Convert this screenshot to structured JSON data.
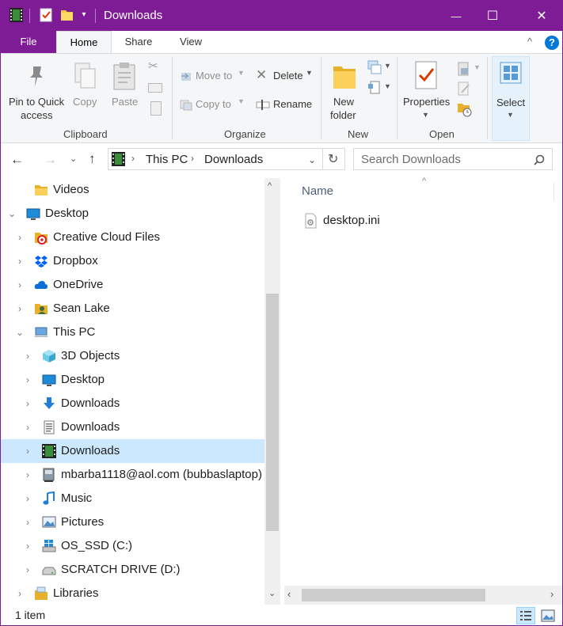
{
  "window": {
    "title": "Downloads"
  },
  "titlebar": {
    "minimize": "—",
    "maximize": "☐",
    "close": "✕"
  },
  "tabs": {
    "file": "File",
    "home": "Home",
    "share": "Share",
    "view": "View"
  },
  "ribbon": {
    "clipboard": {
      "pin": "Pin to Quick access",
      "pin_line1": "Pin to Quick",
      "pin_line2": "access",
      "copy": "Copy",
      "paste": "Paste",
      "group": "Clipboard"
    },
    "organize": {
      "move_to": "Move to",
      "copy_to": "Copy to",
      "delete": "Delete",
      "rename": "Rename",
      "group": "Organize"
    },
    "new": {
      "new_folder_line1": "New",
      "new_folder_line2": "folder",
      "group": "New"
    },
    "open": {
      "properties": "Properties",
      "group": "Open"
    },
    "select": {
      "label": "Select"
    }
  },
  "address": {
    "crumbs": [
      "This PC",
      "Downloads"
    ],
    "search_placeholder": "Search Downloads"
  },
  "nav_items": [
    {
      "label": "Videos",
      "icon": "folder-icon",
      "level": 1,
      "chevron": ""
    },
    {
      "label": "Desktop",
      "icon": "desktop-icon",
      "level": 0,
      "chevron": "expanded"
    },
    {
      "label": "Creative Cloud Files",
      "icon": "creative-cloud-icon",
      "level": 1,
      "chevron": "collapsed"
    },
    {
      "label": "Dropbox",
      "icon": "dropbox-icon",
      "level": 1,
      "chevron": "collapsed"
    },
    {
      "label": "OneDrive",
      "icon": "onedrive-icon",
      "level": 1,
      "chevron": "collapsed"
    },
    {
      "label": "Sean Lake",
      "icon": "user-folder-icon",
      "level": 1,
      "chevron": "collapsed"
    },
    {
      "label": "This PC",
      "icon": "computer-icon",
      "level": 1,
      "chevron": "expanded"
    },
    {
      "label": "3D Objects",
      "icon": "3d-objects-icon",
      "level": 2,
      "chevron": "collapsed"
    },
    {
      "label": "Desktop",
      "icon": "desktop-icon",
      "level": 2,
      "chevron": "collapsed"
    },
    {
      "label": "Downloads",
      "icon": "download-arrow-icon",
      "level": 2,
      "chevron": "collapsed"
    },
    {
      "label": "Downloads",
      "icon": "document-icon",
      "level": 2,
      "chevron": "collapsed"
    },
    {
      "label": "Downloads",
      "icon": "film-icon",
      "level": 2,
      "chevron": "collapsed",
      "selected": true
    },
    {
      "label": "mbarba1118@aol.com (bubbaslaptop)",
      "icon": "network-drive-icon",
      "level": 2,
      "chevron": "collapsed"
    },
    {
      "label": "Music",
      "icon": "music-icon",
      "level": 2,
      "chevron": "collapsed"
    },
    {
      "label": "Pictures",
      "icon": "pictures-icon",
      "level": 2,
      "chevron": "collapsed"
    },
    {
      "label": "OS_SSD (C:)",
      "icon": "windows-drive-icon",
      "level": 2,
      "chevron": "collapsed"
    },
    {
      "label": "SCRATCH DRIVE (D:)",
      "icon": "drive-icon",
      "level": 2,
      "chevron": "collapsed"
    },
    {
      "label": "Libraries",
      "icon": "libraries-icon",
      "level": 1,
      "chevron": "collapsed"
    }
  ],
  "content": {
    "column_name": "Name",
    "files": [
      {
        "name": "desktop.ini",
        "icon": "settings-file-icon"
      }
    ]
  },
  "status": {
    "items": "1 item"
  },
  "colors": {
    "accent": "#7e1c96",
    "selection": "#cce8ff",
    "help": "#0078d7"
  }
}
